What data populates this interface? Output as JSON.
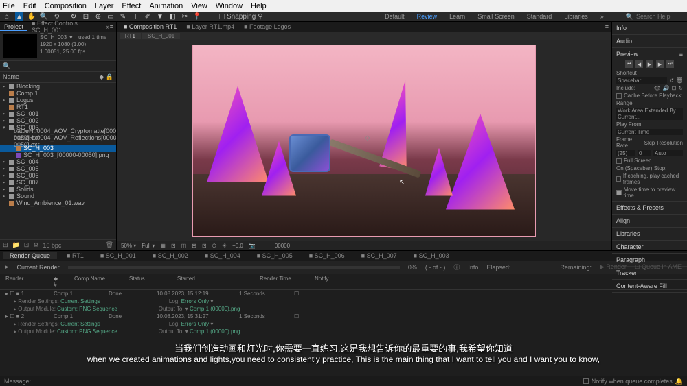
{
  "menu": {
    "file": "File",
    "edit": "Edit",
    "composition": "Composition",
    "layer": "Layer",
    "effect": "Effect",
    "animation": "Animation",
    "view": "View",
    "window": "Window",
    "help": "Help"
  },
  "toolbar": {
    "snapping": "Snapping",
    "workspace": {
      "default": "Default",
      "review": "Review",
      "learn": "Learn",
      "small": "Small Screen",
      "standard": "Standard",
      "libraries": "Libraries"
    },
    "search_ph": "Search Help"
  },
  "project": {
    "tab_project": "Project",
    "tab_effects": "Effect Controls SC_H_001",
    "meta_name": "SC_H_003 ▼ , used 1 time",
    "meta_res": "1920 x 1080 (1.00)",
    "meta_dur": "1.00051, 25.00 fps",
    "name_col": "Name",
    "items": [
      {
        "label": "Blocking",
        "kind": "folder",
        "indent": 0
      },
      {
        "label": "Comp 1",
        "kind": "comp",
        "indent": 0
      },
      {
        "label": "Logos",
        "kind": "folder",
        "indent": 0
      },
      {
        "label": "RT1",
        "kind": "comp",
        "indent": 0
      },
      {
        "label": "SC_001",
        "kind": "folder",
        "indent": 0
      },
      {
        "label": "SC_002",
        "kind": "folder",
        "indent": 0
      },
      {
        "label": "SC_003",
        "kind": "folder",
        "indent": 0,
        "open": true
      },
      {
        "label": "battleH..0004_AOV_Cryptomatte[0000-0050].exr",
        "kind": "file",
        "indent": 1
      },
      {
        "label": "battleH..0004_AOV_Reflections[0000-0050].exr",
        "kind": "file",
        "indent": 1
      },
      {
        "label": "SC_H_003",
        "kind": "comp",
        "indent": 1,
        "selected": true
      },
      {
        "label": "SC_H_003_[00000-00050].png",
        "kind": "img",
        "indent": 1
      },
      {
        "label": "SC_004",
        "kind": "folder",
        "indent": 0
      },
      {
        "label": "SC_005",
        "kind": "folder",
        "indent": 0
      },
      {
        "label": "SC_006",
        "kind": "folder",
        "indent": 0
      },
      {
        "label": "SC_007",
        "kind": "folder",
        "indent": 0
      },
      {
        "label": "Solids",
        "kind": "folder",
        "indent": 0
      },
      {
        "label": "Sound",
        "kind": "folder",
        "indent": 0
      },
      {
        "label": "Wind_Ambience_01.wav",
        "kind": "file",
        "indent": 0
      }
    ],
    "footer_bpc": "16 bpc"
  },
  "comp": {
    "tabs": [
      {
        "label": "Composition RT1",
        "active": true
      },
      {
        "label": "Layer RT1.mp4"
      },
      {
        "label": "Footage Logos"
      }
    ],
    "subtabs": [
      {
        "label": "RT1",
        "active": true
      },
      {
        "label": "SC_H_001"
      }
    ],
    "controls": {
      "zoom": "50%",
      "res": "Full",
      "exp": "+0.0",
      "time": "00000"
    }
  },
  "right": {
    "info": "Info",
    "audio": "Audio",
    "preview": "Preview",
    "shortcut_lbl": "Shortcut",
    "shortcut": "Spacebar",
    "include_lbl": "Include:",
    "cache_before": "Cache Before Playback",
    "range_lbl": "Range",
    "range": "Work Area Extended By Current...",
    "playfrom_lbl": "Play From",
    "playfrom": "Current Time",
    "framerate_lbl": "Frame Rate",
    "skip_lbl": "Skip",
    "resolution_lbl": "Resolution",
    "fps": "(25)",
    "skip": "0",
    "res": "Auto",
    "fullscreen": "Full Screen",
    "spacebar_stop": "On (Spacebar) Stop:",
    "caching_play": "If caching, play cached frames",
    "move_time": "Move time to preview time",
    "panels": [
      "Effects & Presets",
      "Align",
      "Libraries",
      "Character",
      "Paragraph",
      "Tracker",
      "Content-Aware Fill"
    ]
  },
  "rq": {
    "tab_rq": "Render Queue",
    "tabs": [
      "RT1",
      "SC_H_001",
      "SC_H_002",
      "SC_H_004",
      "SC_H_005",
      "SC_H_006",
      "SC_H_007",
      "SC_H_003"
    ],
    "current": "Current Render",
    "pct": "0%",
    "of": "( - of - )",
    "info": "Info",
    "elapsed": "Elapsed:",
    "remaining": "Remaining:",
    "render_btn": "Render",
    "ame_btn": "Queue in AME",
    "th": {
      "render": "Render",
      "num": "#",
      "comp": "Comp Name",
      "status": "Status",
      "started": "Started",
      "rtime": "Render Time",
      "notify": "Notify"
    },
    "rows": [
      {
        "num": "1",
        "comp": "Comp 1",
        "status": "Done",
        "started": "10.08.2023, 15:12:19",
        "rtime": "1 Seconds"
      },
      {
        "num": "2",
        "comp": "Comp 1",
        "status": "Done",
        "started": "10.08.2023, 15:31:27",
        "rtime": "1 Seconds"
      }
    ],
    "render_settings": "Render Settings:",
    "rs_val": "Current Settings",
    "output_module": "Output Module:",
    "om_val": "Custom: PNG Sequence",
    "log": "Log:",
    "log_val": "Errors Only",
    "output_to": "Output To:",
    "ot_val": "Comp 1 (00000).png"
  },
  "subtitle": {
    "cn": "当我们创造动画和灯光时,你需要一直练习,这是我想告诉你的最重要的事,我希望你知道",
    "en": "when we created animations and lights,you need to consistently practice, This is the main thing that I want to tell you and I want you to know,"
  },
  "status": {
    "msg": "Message:",
    "notify": "Notify when queue completes"
  }
}
